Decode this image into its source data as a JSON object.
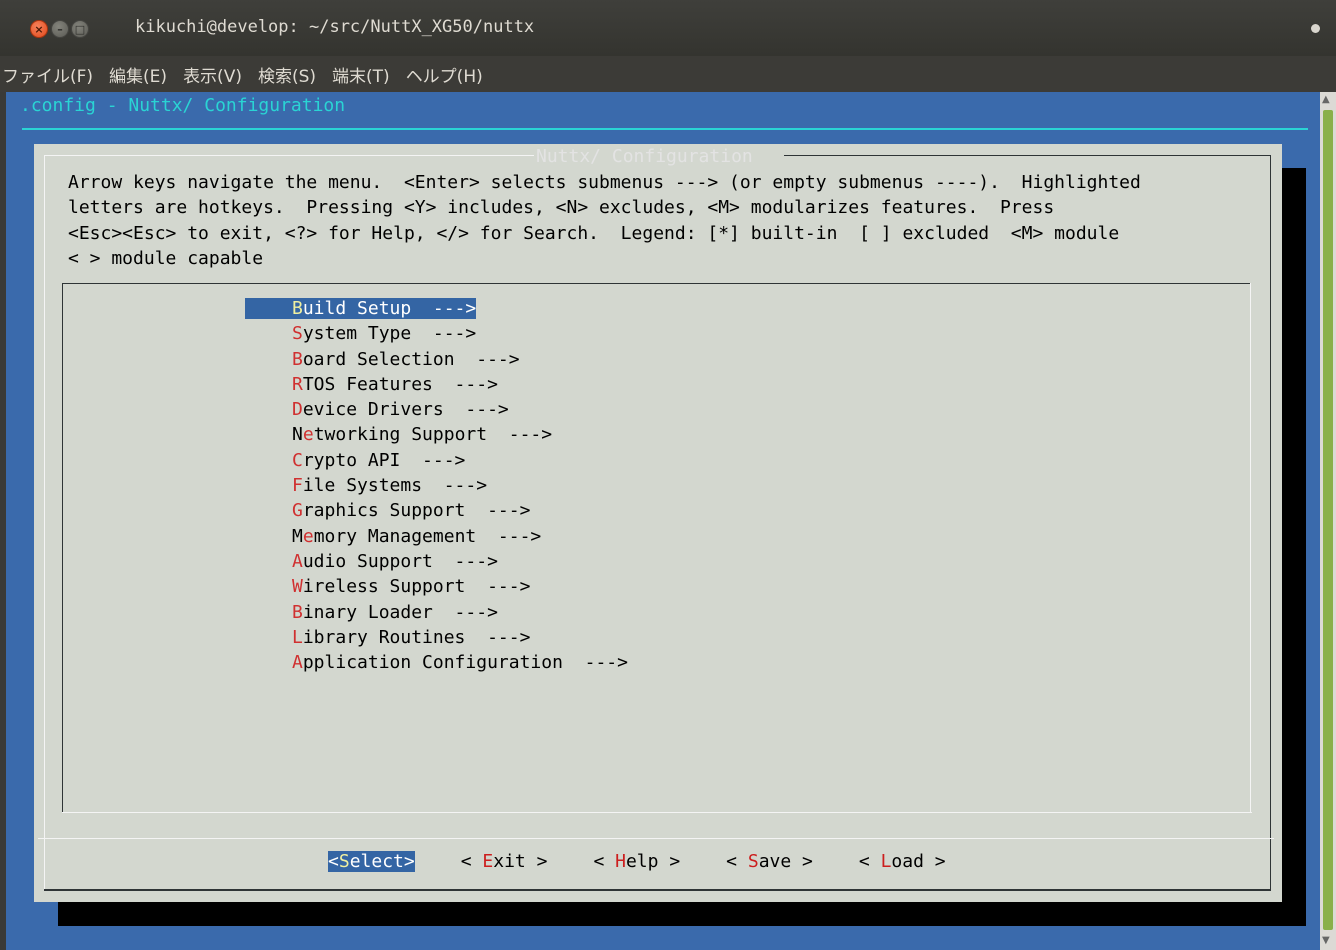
{
  "window": {
    "title": "kikuchi@develop: ~/src/NuttX_XG50/nuttx",
    "buttons": {
      "close": "×",
      "minimize": "–",
      "maximize": "□"
    }
  },
  "menubar": {
    "items": [
      "ファイル(F)",
      "編集(E)",
      "表示(V)",
      "検索(S)",
      "端末(T)",
      "ヘルプ(H)"
    ]
  },
  "terminal": {
    "config_title": ".config - Nuttx/ Configuration",
    "dialog_heading": "Nuttx/ Configuration",
    "help_text": "Arrow keys navigate the menu.  <Enter> selects submenus ---> (or empty submenus ----).  Highlighted\nletters are hotkeys.  Pressing <Y> includes, <N> excludes, <M> modularizes features.  Press\n<Esc><Esc> to exit, <?> for Help, </> for Search.  Legend: [*] built-in  [ ] excluded  <M> module\n< > module capable",
    "menu_items": [
      {
        "hotkey": "B",
        "rest": "uild Setup  --->",
        "selected": true
      },
      {
        "hotkey": "S",
        "rest": "ystem Type  --->"
      },
      {
        "hotkey": "B",
        "rest": "oard Selection  --->"
      },
      {
        "hotkey": "R",
        "rest": "TOS Features  --->"
      },
      {
        "hotkey": "D",
        "rest": "evice Drivers  --->"
      },
      {
        "prefix": "N",
        "hotkey": "e",
        "rest": "tworking Support  --->"
      },
      {
        "hotkey": "C",
        "rest": "rypto API  --->"
      },
      {
        "hotkey": "F",
        "rest": "ile Systems  --->"
      },
      {
        "hotkey": "G",
        "rest": "raphics Support  --->"
      },
      {
        "prefix": "M",
        "hotkey": "e",
        "rest": "mory Management  --->"
      },
      {
        "hotkey": "A",
        "rest": "udio Support  --->"
      },
      {
        "hotkey": "W",
        "rest": "ireless Support  --->"
      },
      {
        "hotkey": "B",
        "rest": "inary Loader  --->"
      },
      {
        "hotkey": "L",
        "rest": "ibrary Routines  --->"
      },
      {
        "hotkey": "A",
        "rest": "pplication Configuration  --->"
      }
    ],
    "buttons": [
      {
        "pre": "<",
        "hotkey": "S",
        "post": "elect>",
        "active": true
      },
      {
        "pre": "< ",
        "hotkey": "E",
        "post": "xit >"
      },
      {
        "pre": "< ",
        "hotkey": "H",
        "post": "elp >"
      },
      {
        "pre": "< ",
        "hotkey": "S",
        "post": "ave >"
      },
      {
        "pre": "< ",
        "hotkey": "L",
        "post": "oad >"
      }
    ]
  }
}
